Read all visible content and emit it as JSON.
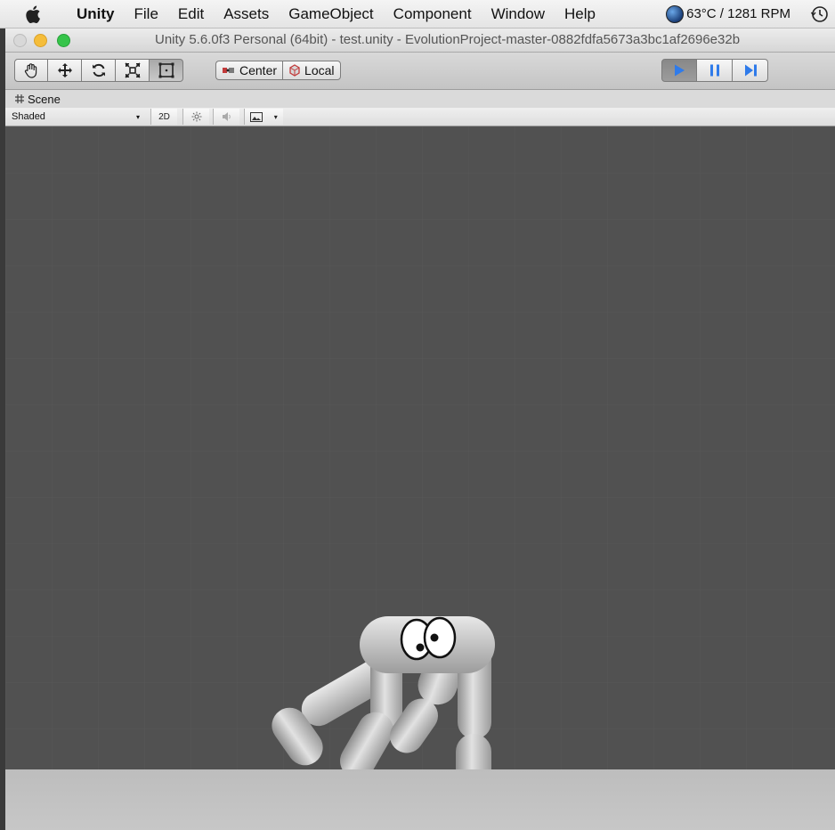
{
  "menubar": {
    "app_name": "Unity",
    "items": [
      "File",
      "Edit",
      "Assets",
      "GameObject",
      "Component",
      "Window",
      "Help"
    ],
    "status_text": "63°C / 1281 RPM",
    "icons": [
      "apple-icon",
      "globe-icon",
      "time-machine-icon"
    ]
  },
  "window": {
    "title": "Unity 5.6.0f3 Personal (64bit) - test.unity - EvolutionProject-master-0882fdfa5673a3bc1af2696e32b"
  },
  "toolbar": {
    "tools": [
      "hand-tool-icon",
      "move-tool-icon",
      "rotate-tool-icon",
      "scale-tool-icon",
      "rect-tool-icon"
    ],
    "active_tool": "rect-tool-icon",
    "pivot_center_label": "Center",
    "pivot_local_label": "Local",
    "play_controls": [
      "play-icon",
      "pause-icon",
      "step-icon"
    ],
    "accent_color": "#2f7bea"
  },
  "scene": {
    "tab_label": "Scene",
    "shading_mode": "Shaded",
    "mode_2d_label": "2D",
    "viewport_color": "#515151",
    "ground_color": "#c2c2c2"
  }
}
